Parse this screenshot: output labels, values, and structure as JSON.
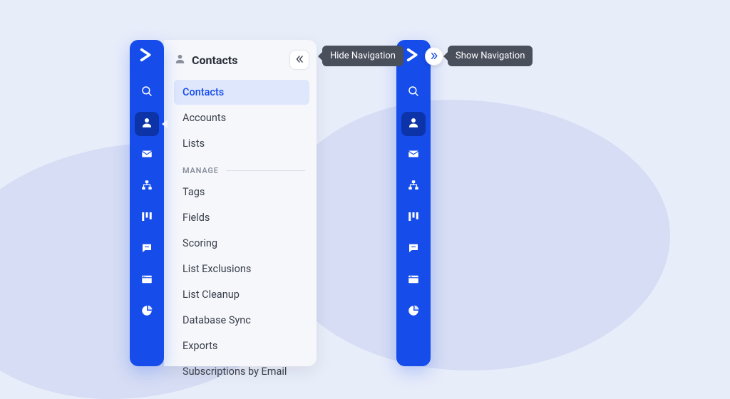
{
  "tooltips": {
    "hide": "Hide Navigation",
    "show": "Show Navigation"
  },
  "panel": {
    "title": "Contacts",
    "items_primary": [
      "Contacts",
      "Accounts",
      "Lists"
    ],
    "section_label": "MANAGE",
    "items_manage": [
      "Tags",
      "Fields",
      "Scoring",
      "List Exclusions",
      "List Cleanup",
      "Database Sync",
      "Exports",
      "Subscriptions by Email"
    ]
  },
  "rail_icons": [
    "search",
    "contacts",
    "mail",
    "automations",
    "deals",
    "conversations",
    "site",
    "reports"
  ]
}
